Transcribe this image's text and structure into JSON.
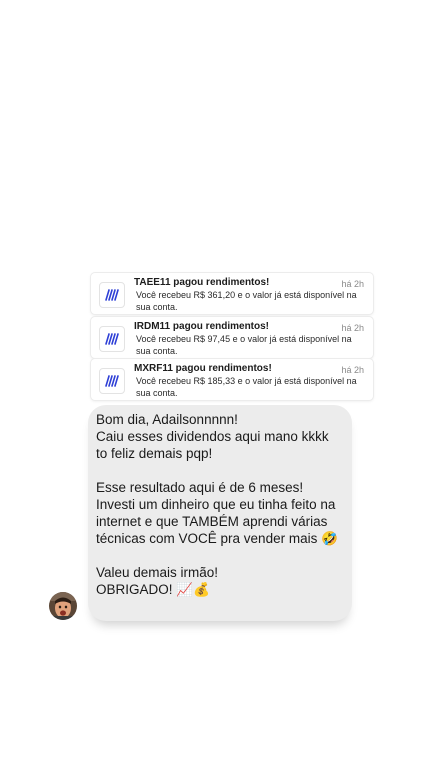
{
  "notifications": [
    {
      "title": "TAEE11 pagou rendimentos!",
      "time": "há 2h",
      "body": "Você recebeu  R$ 361,20 e o valor já está disponível na sua conta."
    },
    {
      "title": "IRDM11 pagou rendimentos!",
      "time": "há 2h",
      "body": "Você recebeu  R$ 97,45 e o valor já está disponível na sua conta."
    },
    {
      "title": "MXRF11 pagou rendimentos!",
      "time": "há 2h",
      "body": "Você recebeu  R$ 185,33 e o valor já está disponível na sua conta."
    }
  ],
  "message": {
    "paragraph1": "Bom dia, Adailsonnnnn!\nCaiu esses dividendos aqui mano kkkk\nto feliz demais pqp!",
    "paragraph2": "Esse resultado aqui é de 6 meses!\nInvesti um dinheiro que eu tinha feito na\ninternet e que TAMBÉM aprendi várias\ntécnicas com VOCÊ pra vender mais 🤣",
    "paragraph3": "Valeu demais irmão!\nOBRIGADO! 📈💰"
  },
  "icons": {
    "notification_logo": "broker-logo-icon",
    "avatar": "user-avatar"
  },
  "colors": {
    "bubble": "#ececec",
    "logo_blue": "#2e3fd6",
    "time_gray": "#8a8a8a"
  }
}
